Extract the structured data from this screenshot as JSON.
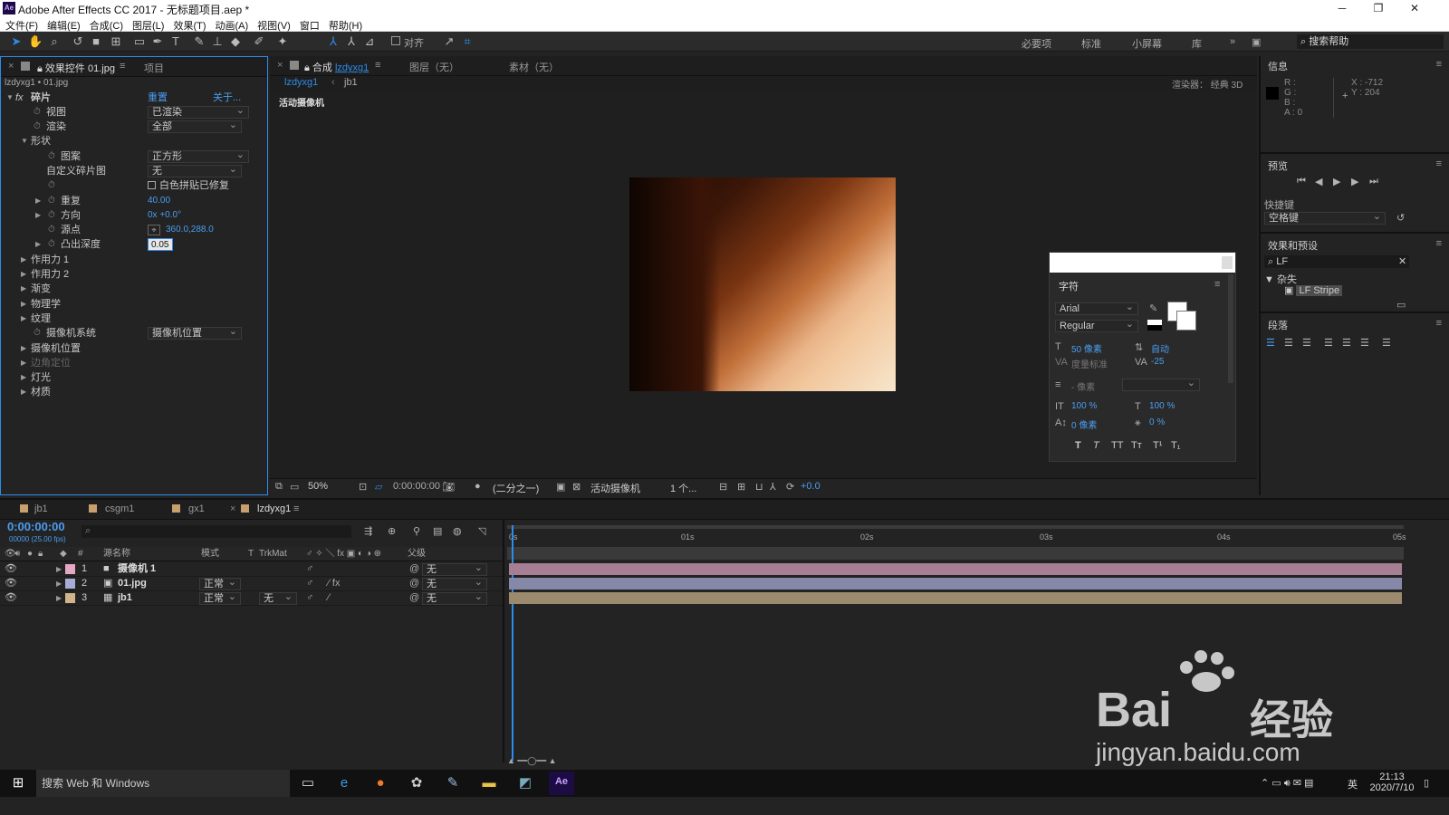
{
  "app": {
    "title": "Adobe After Effects CC 2017 - 无标题项目.aep *",
    "logo": "Ae",
    "menu": [
      "文件(F)",
      "编辑(E)",
      "合成(C)",
      "图层(L)",
      "效果(T)",
      "动画(A)",
      "视图(V)",
      "窗口",
      "帮助(H)"
    ],
    "align_label": "对齐",
    "workspaces": [
      "必要项",
      "标准",
      "小屏幕",
      "库"
    ],
    "search_help": "搜索帮助"
  },
  "effect_panel": {
    "tab_label": "效果控件 01.jpg",
    "tab2": "项目",
    "path": "lzdyxg1 • 01.jpg",
    "effect_name": "碎片",
    "reset": "重置",
    "about": "关于...",
    "rows": [
      {
        "label": "视图",
        "value": "已渲染"
      },
      {
        "label": "渲染",
        "value": "全部"
      },
      {
        "label": "形状"
      },
      {
        "label": "图案",
        "value": "正方形"
      },
      {
        "label": "自定义碎片图",
        "value": "无"
      },
      {
        "label": "",
        "check": "白色拼贴已修复"
      },
      {
        "label": "重复",
        "value": "40.00"
      },
      {
        "label": "方向",
        "value": "0x +0.0°"
      },
      {
        "label": "源点",
        "value": "360.0,288.0"
      },
      {
        "label": "凸出深度",
        "value": "0.05"
      },
      {
        "label": "作用力 1"
      },
      {
        "label": "作用力 2"
      },
      {
        "label": "渐变"
      },
      {
        "label": "物理学"
      },
      {
        "label": "纹理"
      },
      {
        "label": "摄像机系统",
        "value": "摄像机位置"
      },
      {
        "label": "摄像机位置"
      },
      {
        "label": "边角定位"
      },
      {
        "label": "灯光"
      },
      {
        "label": "材质"
      }
    ]
  },
  "comp_panel": {
    "tab_label": "合成",
    "comp_name": "lzdyxg1",
    "layer_tab": "图层（无）",
    "footage_tab": "素材（无）",
    "crumbs": [
      "lzdyxg1",
      "jb1"
    ],
    "renderer": "渲染器： 经典 3D",
    "camera_label": "活动摄像机",
    "zoom": "50%",
    "time": "0:00:00:00",
    "resolution": "(二分之一)",
    "view_camera": "活动摄像机",
    "views": "1 个...",
    "exposure": "+0.0"
  },
  "char_panel": {
    "title": "字符",
    "font": "Arial",
    "style": "Regular",
    "size": "50 像素",
    "leading": "自动",
    "kerning": "度量标准",
    "tracking": "-25",
    "stroke": "- 像素",
    "vscale": "100 %",
    "hscale": "100 %",
    "baseline": "0 像素",
    "tsume": "0 %",
    "styles": [
      "T",
      "T",
      "TT",
      "Tт",
      "T¹",
      "T₁"
    ]
  },
  "info": {
    "title": "信息",
    "r": "R :",
    "g": "G :",
    "b": "B :",
    "a": "A : 0",
    "x": "X : -712",
    "y": "Y : 204"
  },
  "preview": {
    "title": "预览",
    "shortcut_label": "快捷键",
    "shortcut": "空格键"
  },
  "effects_presets": {
    "title": "效果和预设",
    "search": "LF",
    "category": "杂失",
    "item": "LF Stripe"
  },
  "paragraph": {
    "title": "段落"
  },
  "timeline": {
    "tabs": [
      "jb1",
      "csgm1",
      "gx1",
      "lzdyxg1"
    ],
    "timecode": "0:00:00:00",
    "fps": "00000 (25.00 fps)",
    "headers": {
      "num": "#",
      "name": "源名称",
      "mode": "模式",
      "t": "T",
      "trkmat": "TrkMat",
      "parent": "父级"
    },
    "ruler": [
      "0s",
      "01s",
      "02s",
      "03s",
      "04s",
      "05s"
    ],
    "layers": [
      {
        "num": "1",
        "name": "摄像机 1",
        "mode": "",
        "trkmat": "",
        "parent": "无",
        "color": "#e6a7c4"
      },
      {
        "num": "2",
        "name": "01.jpg",
        "mode": "正常",
        "trkmat": "",
        "parent": "无",
        "color": "#a8acd6"
      },
      {
        "num": "3",
        "name": "jb1",
        "mode": "正常",
        "trkmat": "无",
        "parent": "无",
        "color": "#d2b48c"
      }
    ]
  },
  "taskbar": {
    "search": "搜索 Web 和 Windows",
    "time": "21:13",
    "date": "2020/7/10",
    "lang": "英"
  },
  "watermark": {
    "brand": "Bai",
    "cn": "经验",
    "url": "jingyan.baidu.com"
  }
}
